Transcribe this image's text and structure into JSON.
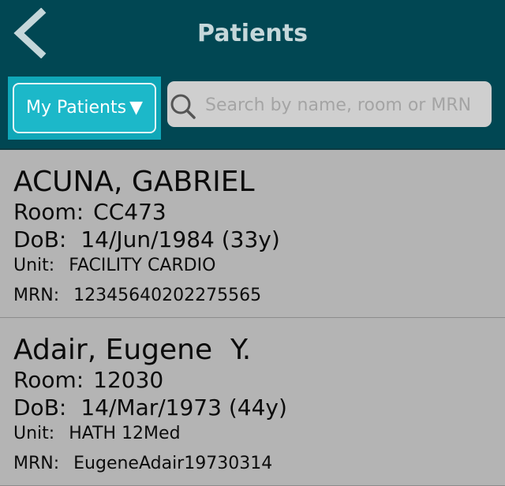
{
  "header": {
    "title": "Patients",
    "back_icon": "chevron-left-icon"
  },
  "filter": {
    "label": "My Patients",
    "caret": "▼"
  },
  "search": {
    "placeholder": "Search by name, room or MRN",
    "value": "",
    "icon": "search-icon"
  },
  "patients": [
    {
      "name": "ACUNA, GABRIEL",
      "room_label": "Room:",
      "room": "CC473",
      "dob_label": "DoB:",
      "dob": "14/Jun/1984 (33y)",
      "unit_label": "Unit:",
      "unit": "FACILITY CARDIO",
      "mrn_label": "MRN:",
      "mrn": "12345640202275565"
    },
    {
      "name": "Adair, Eugene  Y.",
      "room_label": "Room:",
      "room": "12030",
      "dob_label": "DoB:",
      "dob": "14/Mar/1973 (44y)",
      "unit_label": "Unit:",
      "unit": "HATH 12Med",
      "mrn_label": "MRN:",
      "mrn": "EugeneAdair19730314"
    }
  ],
  "colors": {
    "header_bg": "#014753",
    "title_text": "#c5d7da",
    "filter_bg": "#1cb8c9",
    "list_bg": "#b4b4b4",
    "search_bg": "#cfcfcf"
  }
}
